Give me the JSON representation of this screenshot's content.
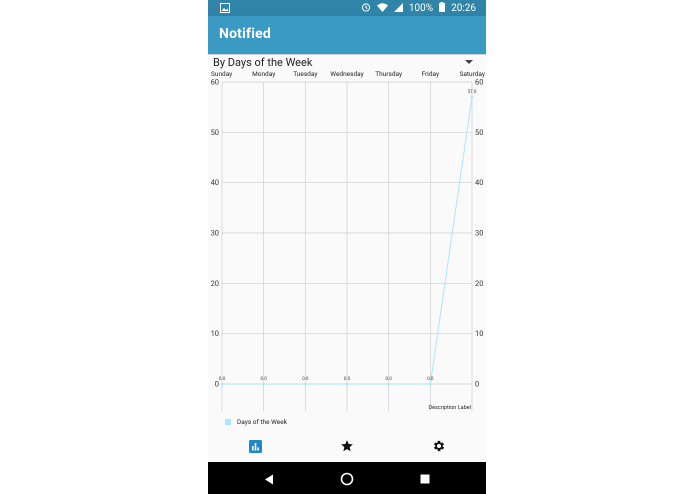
{
  "status_bar": {
    "battery": "100%",
    "time": "20:26",
    "icons": [
      "image-icon",
      "alarm-icon",
      "wifi-icon",
      "signal-icon",
      "battery-icon"
    ]
  },
  "app_bar": {
    "title": "Notified"
  },
  "dropdown": {
    "selected": "By Days of the Week"
  },
  "chart_data": {
    "type": "line",
    "categories": [
      "Sunday",
      "Monday",
      "Tuesday",
      "Wednesday",
      "Thursday",
      "Friday",
      "Saturday"
    ],
    "series": [
      {
        "name": "Days of the Week",
        "values": [
          0,
          0,
          0,
          0,
          0,
          0,
          57
        ],
        "color": "#a9e6ff"
      }
    ],
    "value_labels": [
      "0.0",
      "0.0",
      "0.0",
      "0.0",
      "0.0",
      "0.0",
      "57.0"
    ],
    "ylim": [
      0,
      60
    ],
    "yticks": [
      0,
      10,
      20,
      30,
      40,
      50,
      60
    ],
    "y_axis_left": true,
    "y_axis_right": true,
    "x_axis_top": true,
    "grid": true,
    "description": "Description Label",
    "legend_position": "bottom-left"
  },
  "bottom_nav": {
    "items": [
      {
        "icon": "bar-chart-icon",
        "active": true
      },
      {
        "icon": "star-icon",
        "active": false
      },
      {
        "icon": "gear-icon",
        "active": false
      }
    ],
    "active_color": "#1e88c8"
  },
  "system_nav": {
    "icons": [
      "back-icon",
      "home-icon",
      "recents-icon"
    ]
  }
}
